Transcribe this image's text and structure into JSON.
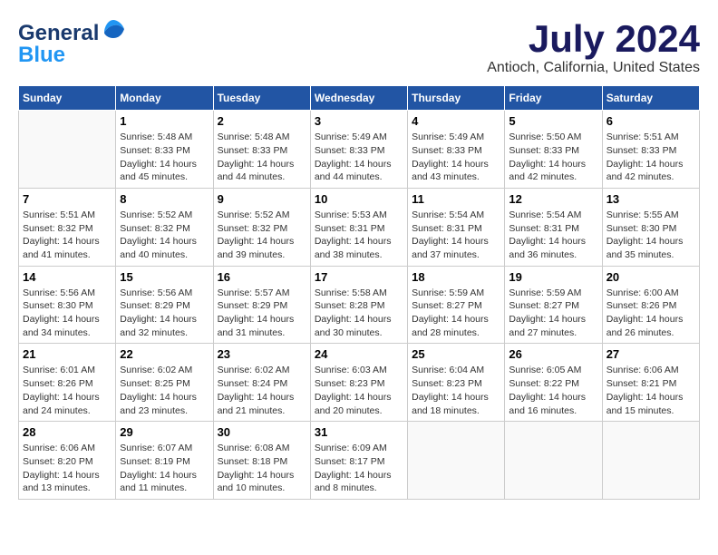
{
  "header": {
    "logo_line1": "General",
    "logo_line2": "Blue",
    "title": "July 2024",
    "subtitle": "Antioch, California, United States"
  },
  "weekdays": [
    "Sunday",
    "Monday",
    "Tuesday",
    "Wednesday",
    "Thursday",
    "Friday",
    "Saturday"
  ],
  "weeks": [
    [
      {
        "day": "",
        "info": ""
      },
      {
        "day": "1",
        "info": "Sunrise: 5:48 AM\nSunset: 8:33 PM\nDaylight: 14 hours\nand 45 minutes."
      },
      {
        "day": "2",
        "info": "Sunrise: 5:48 AM\nSunset: 8:33 PM\nDaylight: 14 hours\nand 44 minutes."
      },
      {
        "day": "3",
        "info": "Sunrise: 5:49 AM\nSunset: 8:33 PM\nDaylight: 14 hours\nand 44 minutes."
      },
      {
        "day": "4",
        "info": "Sunrise: 5:49 AM\nSunset: 8:33 PM\nDaylight: 14 hours\nand 43 minutes."
      },
      {
        "day": "5",
        "info": "Sunrise: 5:50 AM\nSunset: 8:33 PM\nDaylight: 14 hours\nand 42 minutes."
      },
      {
        "day": "6",
        "info": "Sunrise: 5:51 AM\nSunset: 8:33 PM\nDaylight: 14 hours\nand 42 minutes."
      }
    ],
    [
      {
        "day": "7",
        "info": "Sunrise: 5:51 AM\nSunset: 8:32 PM\nDaylight: 14 hours\nand 41 minutes."
      },
      {
        "day": "8",
        "info": "Sunrise: 5:52 AM\nSunset: 8:32 PM\nDaylight: 14 hours\nand 40 minutes."
      },
      {
        "day": "9",
        "info": "Sunrise: 5:52 AM\nSunset: 8:32 PM\nDaylight: 14 hours\nand 39 minutes."
      },
      {
        "day": "10",
        "info": "Sunrise: 5:53 AM\nSunset: 8:31 PM\nDaylight: 14 hours\nand 38 minutes."
      },
      {
        "day": "11",
        "info": "Sunrise: 5:54 AM\nSunset: 8:31 PM\nDaylight: 14 hours\nand 37 minutes."
      },
      {
        "day": "12",
        "info": "Sunrise: 5:54 AM\nSunset: 8:31 PM\nDaylight: 14 hours\nand 36 minutes."
      },
      {
        "day": "13",
        "info": "Sunrise: 5:55 AM\nSunset: 8:30 PM\nDaylight: 14 hours\nand 35 minutes."
      }
    ],
    [
      {
        "day": "14",
        "info": "Sunrise: 5:56 AM\nSunset: 8:30 PM\nDaylight: 14 hours\nand 34 minutes."
      },
      {
        "day": "15",
        "info": "Sunrise: 5:56 AM\nSunset: 8:29 PM\nDaylight: 14 hours\nand 32 minutes."
      },
      {
        "day": "16",
        "info": "Sunrise: 5:57 AM\nSunset: 8:29 PM\nDaylight: 14 hours\nand 31 minutes."
      },
      {
        "day": "17",
        "info": "Sunrise: 5:58 AM\nSunset: 8:28 PM\nDaylight: 14 hours\nand 30 minutes."
      },
      {
        "day": "18",
        "info": "Sunrise: 5:59 AM\nSunset: 8:27 PM\nDaylight: 14 hours\nand 28 minutes."
      },
      {
        "day": "19",
        "info": "Sunrise: 5:59 AM\nSunset: 8:27 PM\nDaylight: 14 hours\nand 27 minutes."
      },
      {
        "day": "20",
        "info": "Sunrise: 6:00 AM\nSunset: 8:26 PM\nDaylight: 14 hours\nand 26 minutes."
      }
    ],
    [
      {
        "day": "21",
        "info": "Sunrise: 6:01 AM\nSunset: 8:26 PM\nDaylight: 14 hours\nand 24 minutes."
      },
      {
        "day": "22",
        "info": "Sunrise: 6:02 AM\nSunset: 8:25 PM\nDaylight: 14 hours\nand 23 minutes."
      },
      {
        "day": "23",
        "info": "Sunrise: 6:02 AM\nSunset: 8:24 PM\nDaylight: 14 hours\nand 21 minutes."
      },
      {
        "day": "24",
        "info": "Sunrise: 6:03 AM\nSunset: 8:23 PM\nDaylight: 14 hours\nand 20 minutes."
      },
      {
        "day": "25",
        "info": "Sunrise: 6:04 AM\nSunset: 8:23 PM\nDaylight: 14 hours\nand 18 minutes."
      },
      {
        "day": "26",
        "info": "Sunrise: 6:05 AM\nSunset: 8:22 PM\nDaylight: 14 hours\nand 16 minutes."
      },
      {
        "day": "27",
        "info": "Sunrise: 6:06 AM\nSunset: 8:21 PM\nDaylight: 14 hours\nand 15 minutes."
      }
    ],
    [
      {
        "day": "28",
        "info": "Sunrise: 6:06 AM\nSunset: 8:20 PM\nDaylight: 14 hours\nand 13 minutes."
      },
      {
        "day": "29",
        "info": "Sunrise: 6:07 AM\nSunset: 8:19 PM\nDaylight: 14 hours\nand 11 minutes."
      },
      {
        "day": "30",
        "info": "Sunrise: 6:08 AM\nSunset: 8:18 PM\nDaylight: 14 hours\nand 10 minutes."
      },
      {
        "day": "31",
        "info": "Sunrise: 6:09 AM\nSunset: 8:17 PM\nDaylight: 14 hours\nand 8 minutes."
      },
      {
        "day": "",
        "info": ""
      },
      {
        "day": "",
        "info": ""
      },
      {
        "day": "",
        "info": ""
      }
    ]
  ]
}
